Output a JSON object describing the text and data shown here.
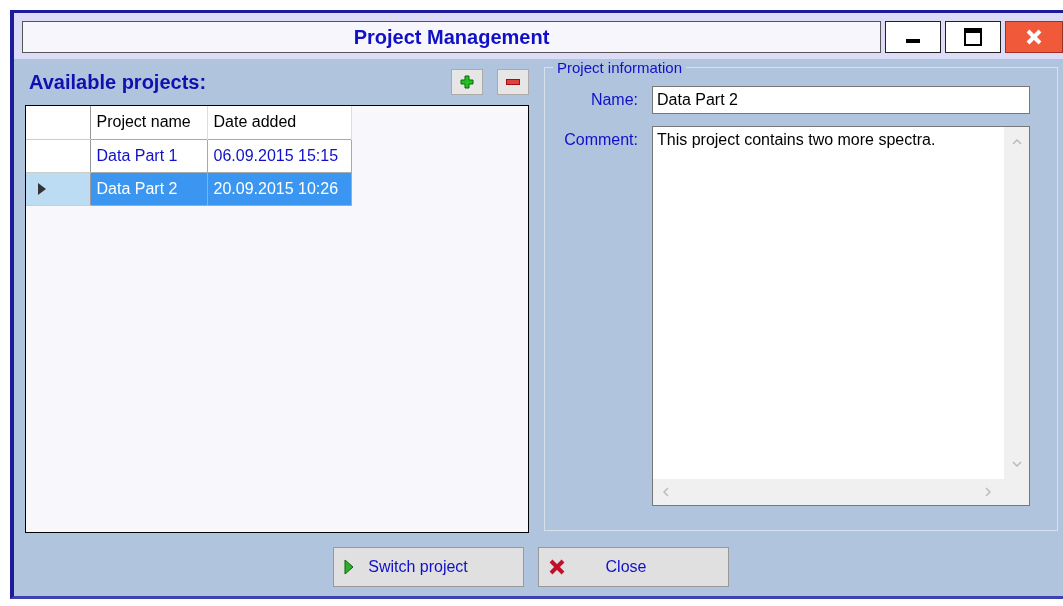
{
  "window": {
    "title": "Project Management",
    "controls": [
      {
        "kind": "minimize"
      },
      {
        "kind": "maximize"
      },
      {
        "kind": "close"
      }
    ]
  },
  "projects": {
    "title": "Available projects:",
    "tools": [
      {
        "kind": "add"
      },
      {
        "kind": "remove"
      }
    ],
    "table": {
      "columns": [
        "Project name",
        "Date added"
      ],
      "rows": [
        {
          "cells": [
            "Data Part 1",
            "06.09.2015 15:15"
          ],
          "selected": false
        },
        {
          "cells": [
            "Data Part 2",
            "20.09.2015 10:26"
          ],
          "selected": true
        }
      ]
    }
  },
  "project_information": {
    "title": "Project information",
    "name_label": "Name:",
    "name_value": "Data Part 2",
    "comment_label": "Comment:",
    "comment_value": "This project contains two more spectra."
  },
  "buttons": [
    {
      "label": "Switch project",
      "kind": "switch"
    },
    {
      "label": "Close",
      "kind": "close"
    }
  ]
}
